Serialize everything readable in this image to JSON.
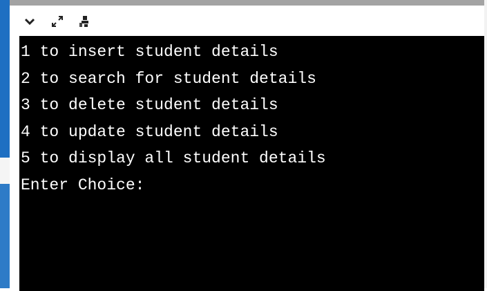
{
  "toolbar": {
    "icons": [
      "chevron-down-icon",
      "expand-icon",
      "pin-person-icon"
    ]
  },
  "console": {
    "lines": [
      "1 to insert student details",
      "2 to search for student details",
      "3 to delete student details",
      "4 to update student details",
      "5 to display all student details",
      "Enter Choice:"
    ]
  },
  "colors": {
    "console_background": "#000000",
    "console_text": "#ffffff",
    "accent_strip": "#1e6fc2"
  }
}
